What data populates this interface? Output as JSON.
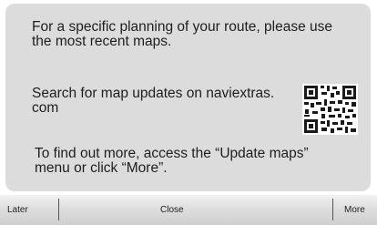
{
  "message": {
    "line1a": "For a specific planning of your route, please use",
    "line1b": "the most recent maps.",
    "line2a": "Search for map updates on naviextras.",
    "line2b": "com",
    "line3a": "To find out more, access the “Update maps”",
    "line3b": "menu or click “More”."
  },
  "qr_icon": "qr-code-icon",
  "buttons": {
    "later": "Later",
    "close": "Close",
    "more": "More"
  },
  "colors": {
    "card_background": "#dcdcdc",
    "text": "#1e1e1e",
    "bar_top": "#f2f2f2",
    "bar_bottom": "#cfcfcf"
  }
}
